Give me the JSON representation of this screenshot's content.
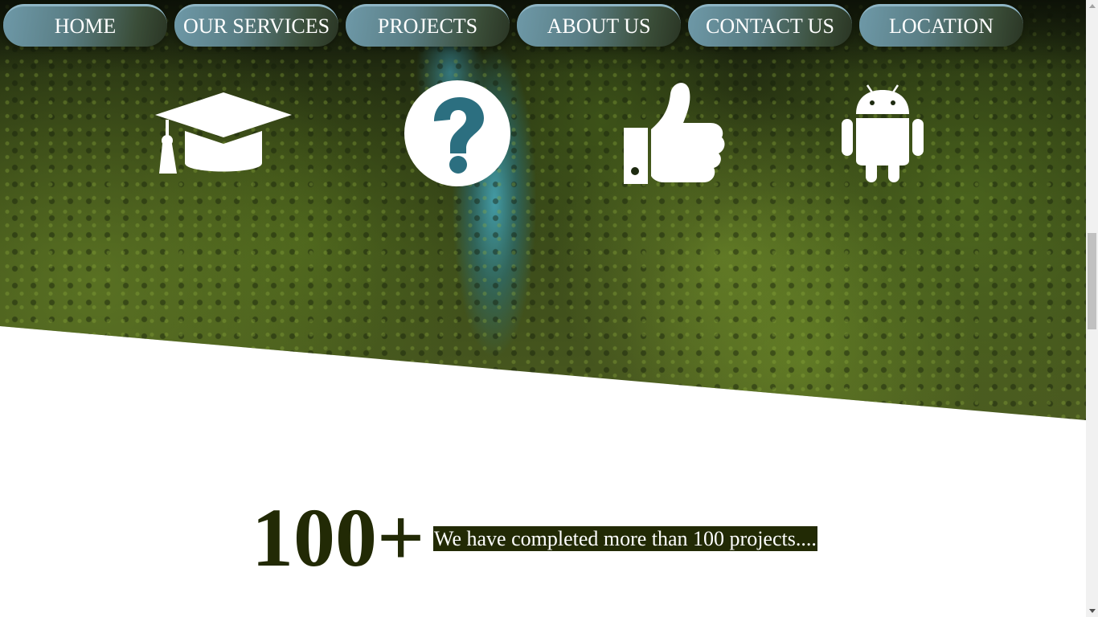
{
  "nav": {
    "items": [
      {
        "label": "HOME"
      },
      {
        "label": "OUR SERVICES"
      },
      {
        "label": "PROJECTS"
      },
      {
        "label": "ABOUT US"
      },
      {
        "label": "CONTACT US"
      },
      {
        "label": "LOCATION"
      }
    ]
  },
  "icons": [
    {
      "name": "graduation-cap-icon"
    },
    {
      "name": "question-circle-icon"
    },
    {
      "name": "thumbs-up-icon"
    },
    {
      "name": "android-icon"
    }
  ],
  "stats": {
    "number": "100+",
    "text": "We have completed more than 100 projects...."
  },
  "colors": {
    "stat_color": "#222a05",
    "nav_gradient_start": "#6e99a8",
    "nav_gradient_end": "#2a3524"
  }
}
